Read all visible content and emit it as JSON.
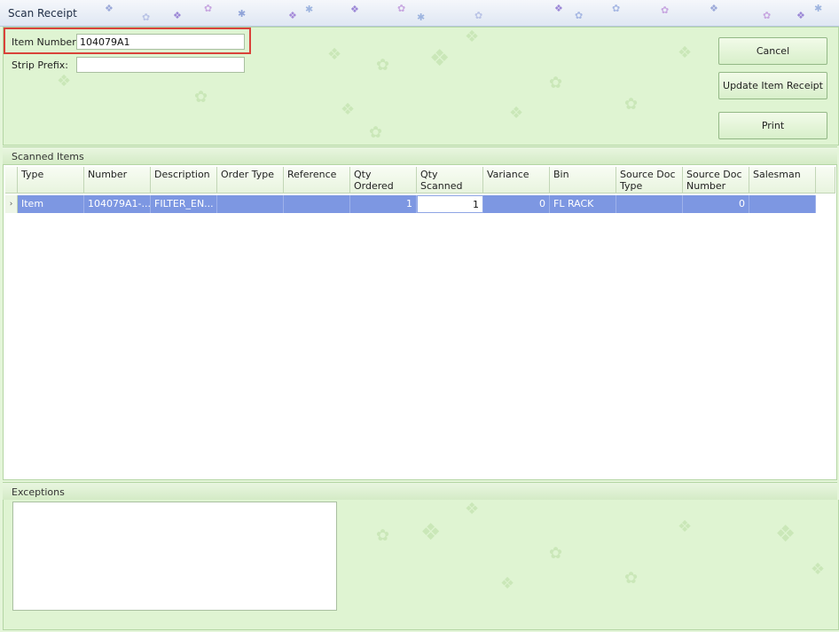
{
  "window": {
    "title": "Scan Receipt"
  },
  "form": {
    "item_number_label": "Item Number:",
    "item_number_value": "104079A1",
    "strip_prefix_label": "Strip Prefix:",
    "strip_prefix_value": ""
  },
  "buttons": {
    "cancel": "Cancel",
    "update": "Update Item Receipt",
    "print": "Print"
  },
  "scanned_items": {
    "title": "Scanned Items",
    "columns": [
      "Type",
      "Number",
      "Description",
      "Order Type",
      "Reference",
      "Qty Ordered",
      "Qty Scanned",
      "Variance",
      "Bin",
      "Source Doc Type",
      "Source Doc Number",
      "Salesman"
    ],
    "rows": [
      [
        "Item",
        "104079A1-...",
        "FILTER_EN...",
        "",
        "",
        "1",
        "1",
        "0",
        "FL RACK",
        "",
        "0",
        ""
      ]
    ],
    "row_selector": "›"
  },
  "exceptions": {
    "title": "Exceptions",
    "value": ""
  },
  "colors": {
    "highlight": "#d9423a",
    "selected_row": "#7d97e2",
    "panel": "#dff4d2"
  }
}
